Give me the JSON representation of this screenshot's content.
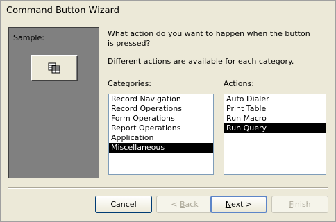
{
  "window": {
    "title": "Command Button Wizard"
  },
  "sample": {
    "label": "Sample:",
    "icon": "query-icon"
  },
  "prompt": {
    "question": "What action do you want to happen when the button is pressed?",
    "hint": "Different actions are available for each category."
  },
  "categories": {
    "label_u": "C",
    "label_rest": "ategories:",
    "items": [
      "Record Navigation",
      "Record Operations",
      "Form Operations",
      "Report Operations",
      "Application",
      "Miscellaneous"
    ],
    "selected": "Miscellaneous"
  },
  "actions": {
    "label_u": "A",
    "label_rest": "ctions:",
    "items": [
      "Auto Dialer",
      "Print Table",
      "Run Macro",
      "Run Query"
    ],
    "selected": "Run Query"
  },
  "buttons": {
    "cancel": "Cancel",
    "back_prefix": "< ",
    "back_u": "B",
    "back_rest": "ack",
    "next_u": "N",
    "next_rest": "ext >",
    "finish_u": "F",
    "finish_rest": "inish"
  }
}
